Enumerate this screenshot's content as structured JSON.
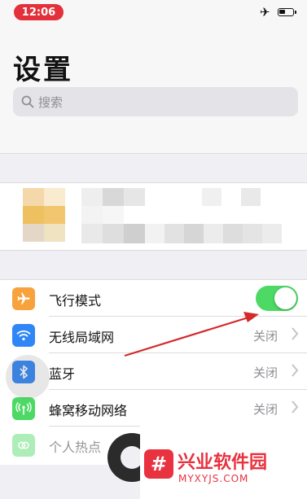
{
  "status_bar": {
    "time": "12:06"
  },
  "header": {
    "title": "设置",
    "search": {
      "placeholder": "搜索"
    }
  },
  "settings": [
    {
      "label": "飞行模式",
      "icon": "airplane-icon",
      "color": "#f7a23c",
      "toggle_on": true
    },
    {
      "label": "无线局域网",
      "icon": "wifi-icon",
      "color": "#2f86f6",
      "value": "关闭"
    },
    {
      "label": "蓝牙",
      "icon": "bluetooth-icon",
      "color": "#2f86f6",
      "value": "关闭"
    },
    {
      "label": "蜂窝移动网络",
      "icon": "cellular-icon",
      "color": "#4cd964",
      "value": "关闭"
    },
    {
      "label": "个人热点",
      "icon": "hotspot-icon",
      "color": "#4cd964",
      "disabled": true
    }
  ],
  "watermark": {
    "name": "兴业软件园",
    "url": "MYXYJS.COM"
  },
  "colors": {
    "accent_red": "#e3303a",
    "toggle_green": "#4cd964",
    "ios_blue": "#2f86f6",
    "airplane_orange": "#f7a23c"
  }
}
